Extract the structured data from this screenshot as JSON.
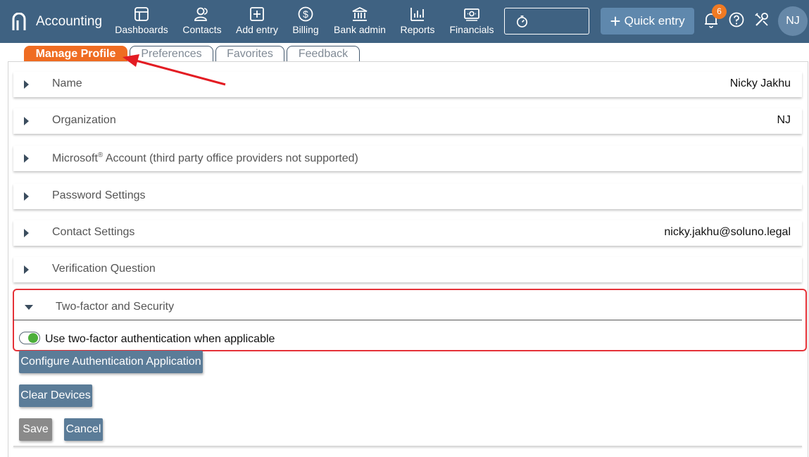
{
  "brand": {
    "name": "Accounting",
    "logo_icon": "accounting-logo-icon"
  },
  "nav": [
    {
      "label": "Dashboards",
      "icon": "dashboard-icon"
    },
    {
      "label": "Contacts",
      "icon": "contacts-icon"
    },
    {
      "label": "Add entry",
      "icon": "add-entry-icon"
    },
    {
      "label": "Billing",
      "icon": "billing-icon"
    },
    {
      "label": "Bank admin",
      "icon": "bank-icon"
    },
    {
      "label": "Reports",
      "icon": "reports-icon"
    },
    {
      "label": "Financials",
      "icon": "financials-icon"
    }
  ],
  "toolbar": {
    "timer_icon": "stopwatch-icon",
    "quick_entry_label": "Quick entry",
    "notification_count": "6",
    "avatar_initials": "NJ"
  },
  "tabs": [
    {
      "label": "Manage Profile",
      "active": true
    },
    {
      "label": "Preferences",
      "active": false
    },
    {
      "label": "Favorites",
      "active": false
    },
    {
      "label": "Feedback",
      "active": false
    }
  ],
  "sections": {
    "name": {
      "label": "Name",
      "value": "Nicky Jakhu"
    },
    "organization": {
      "label": "Organization",
      "value": "NJ"
    },
    "microsoft": {
      "label_prefix": "Microsoft",
      "label_sup": "®",
      "label_suffix": " Account (third party office providers not supported)"
    },
    "password": {
      "label": "Password Settings"
    },
    "contact": {
      "label": "Contact Settings",
      "value": "nicky.jakhu@soluno.legal"
    },
    "verification": {
      "label": "Verification Question"
    },
    "two_factor": {
      "label": "Two-factor and Security",
      "toggle_label": "Use two-factor authentication when applicable",
      "toggle_on": true
    }
  },
  "buttons": {
    "configure_app": "Configure Authentication Application",
    "clear_devices": "Clear Devices",
    "save": "Save",
    "cancel": "Cancel"
  },
  "colors": {
    "topbar": "#3f6282",
    "active_tab": "#ef6c22",
    "highlight": "#e53238",
    "toggle_on": "#4caf3b"
  }
}
